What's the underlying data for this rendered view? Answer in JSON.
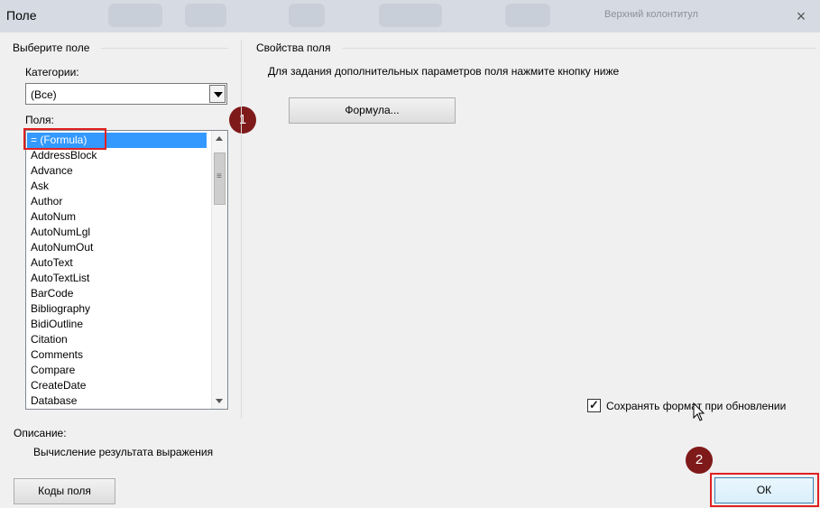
{
  "window": {
    "title": "Поле",
    "background_ribbon_hint": "Верхний колонтитул",
    "close_glyph": "×"
  },
  "left": {
    "group_title": "Выберите поле",
    "categories_label": "Категории:",
    "categories_value": "(Все)",
    "fields_label": "Поля:",
    "fields": [
      "= (Formula)",
      "AddressBlock",
      "Advance",
      "Ask",
      "Author",
      "AutoNum",
      "AutoNumLgl",
      "AutoNumOut",
      "AutoText",
      "AutoTextList",
      "BarCode",
      "Bibliography",
      "BidiOutline",
      "Citation",
      "Comments",
      "Compare",
      "CreateDate",
      "Database"
    ],
    "selected_field": "= (Formula)"
  },
  "right": {
    "group_title": "Свойства поля",
    "hint": "Для задания дополнительных параметров поля нажмите кнопку ниже",
    "formula_button": "Формула...",
    "preserve_format_label": "Сохранять формат при обновлении",
    "preserve_format_checked": true
  },
  "description": {
    "label": "Описание:",
    "text": "Вычисление результата выражения"
  },
  "buttons": {
    "field_codes": "Коды поля",
    "ok": "ОК"
  },
  "annotations": {
    "step1": "1",
    "step2": "2",
    "color": "#7f1a1a",
    "highlight_color": "#e02020"
  },
  "colors": {
    "selection": "#3399ff",
    "dialog_bg": "#f0f0f0"
  }
}
